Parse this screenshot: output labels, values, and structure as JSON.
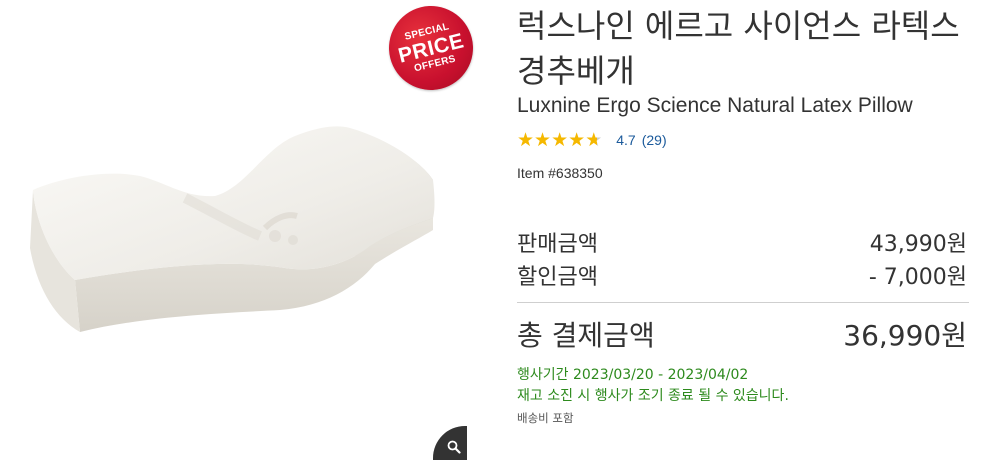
{
  "badge": {
    "line1": "SPECIAL",
    "line2": "PRICE",
    "line3": "OFFERS"
  },
  "product": {
    "title_ko": "럭스나인 에르고 사이언스 라텍스 경추베개",
    "title_en": "Luxnine Ergo Science Natural Latex Pillow",
    "rating": "4.7",
    "rating_count": "(29)",
    "rating_value": 4.7,
    "item_number": "Item #638350"
  },
  "price": {
    "sale_label": "판매금액",
    "sale_value": "43,990원",
    "discount_label": "할인금액",
    "discount_value": "- 7,000원",
    "total_label": "총 결제금액",
    "total_value": "36,990원"
  },
  "promo": {
    "period": "행사기간 2023/03/20 - 2023/04/02",
    "note": "재고 소진 시 행사가 조기 종료 될 수 있습니다."
  },
  "shipping": "배송비 포함",
  "icons": {
    "zoom": "zoom-in-icon",
    "star": "star-icon"
  },
  "colors": {
    "badge": "#c8102e",
    "star": "#f5b800",
    "link": "#1b5a9b",
    "promo": "#2d8a1d",
    "zoom_bg": "#333333"
  }
}
